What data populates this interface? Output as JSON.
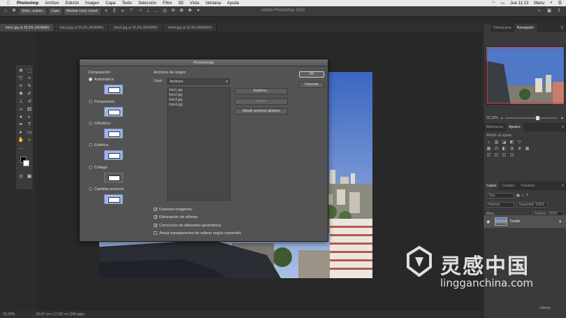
{
  "menubar": {
    "app": "Photoshop",
    "items": [
      "Archivo",
      "Edición",
      "Imagen",
      "Capa",
      "Texto",
      "Selección",
      "Filtro",
      "3D",
      "Vista",
      "Ventana",
      "Ayuda"
    ],
    "clock": "Jue 11:13",
    "user": "Manu"
  },
  "window_title": "Adobe Photoshop 2020",
  "optionsbar": {
    "auto_select": "Selec. autom.:",
    "layer_select": "Capa",
    "show_transform": "Mostrar contr. transf."
  },
  "tabs": [
    {
      "label": "foto1.jpg al 33,3% (RGB/8#)"
    },
    {
      "label": "foto2.jpg al 33,3% (RGB/8#)"
    },
    {
      "label": "foto3.jpg al 33,3% (RGB/8#)"
    },
    {
      "label": "foto4.jpg al 33,3% (RGB/8#)"
    }
  ],
  "statusbar": {
    "zoom": "33,33%",
    "docinfo": "23,97 cm x 17,82 cm (240 ppp)"
  },
  "panels": {
    "top_tabs": [
      "Histograma",
      "Navegador"
    ],
    "nav_zoom": "33,33%",
    "mid_tabs": [
      "Bibliotecas",
      "Ajustes"
    ],
    "adjust_label": "Añadir un ajuste",
    "layer_tabs": [
      "Capas",
      "Canales",
      "Trazados"
    ],
    "kind": "Tipo",
    "blend": "Normal",
    "opacity": "Opacidad: 100%",
    "fill": "Relleno: 100%",
    "lock": "Bloq.:",
    "layer_name": "Fondo"
  },
  "dialog": {
    "title": "Photomerge",
    "layout_heading": "Composición",
    "layouts": [
      {
        "label": "Automática",
        "selected": true
      },
      {
        "label": "Perspectiva",
        "selected": false
      },
      {
        "label": "Cilíndrica",
        "selected": false
      },
      {
        "label": "Esférica",
        "selected": false
      },
      {
        "label": "Collage",
        "selected": false
      },
      {
        "label": "Cambiar posición",
        "selected": false
      }
    ],
    "source_heading": "Archivos de origen",
    "use_label": "Usar:",
    "use_value": "Archivos",
    "files": [
      "foto1.jpg",
      "foto2.jpg",
      "foto3.jpg",
      "foto4.jpg"
    ],
    "browse": "Explorar...",
    "remove": "Quitar",
    "add_open": "Añadir archivos abiertos",
    "ok": "OK",
    "cancel": "Cancelar",
    "options": [
      {
        "label": "Fusionar imágenes",
        "checked": true
      },
      {
        "label": "Eliminación de viñetas",
        "checked": true
      },
      {
        "label": "Corrección de distorsión geométrica",
        "checked": true
      },
      {
        "label": "Áreas transparentes de relleno según contenido",
        "checked": false
      }
    ]
  },
  "watermark": {
    "cn": "灵感中国",
    "en": "lingganchina.com"
  },
  "badge": "Udemy"
}
